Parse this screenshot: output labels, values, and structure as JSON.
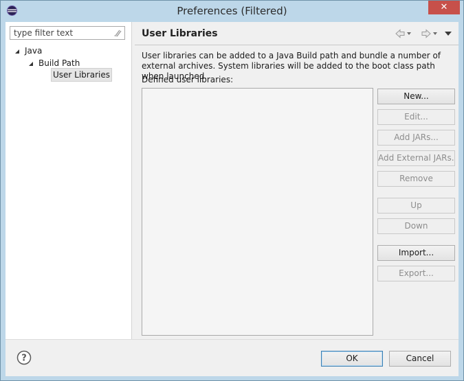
{
  "window": {
    "title": "Preferences (Filtered)",
    "close_label": "✕"
  },
  "filter": {
    "placeholder": "type filter text"
  },
  "tree": [
    {
      "label": "Java"
    },
    {
      "label": "Build Path"
    },
    {
      "label": "User Libraries"
    }
  ],
  "page": {
    "title": "User Libraries",
    "description": "User libraries can be added to a Java Build path and bundle a number of external archives. System libraries will be added to the boot class path when launched.",
    "list_label": "Defined user libraries:"
  },
  "buttons": {
    "new": "New...",
    "edit": "Edit...",
    "add_jars": "Add JARs...",
    "add_external_jars": "Add External JARs...",
    "remove": "Remove",
    "up": "Up",
    "down": "Down",
    "import": "Import...",
    "export": "Export..."
  },
  "dialog": {
    "ok": "OK",
    "cancel": "Cancel"
  },
  "icons": [
    "eclipse-icon",
    "clear-filter-icon",
    "back-icon",
    "forward-icon",
    "view-menu-icon",
    "help-icon"
  ],
  "colors": {
    "titlebar": "#bdd7e9",
    "close": "#c7504a",
    "panel": "#f0f0f0"
  }
}
